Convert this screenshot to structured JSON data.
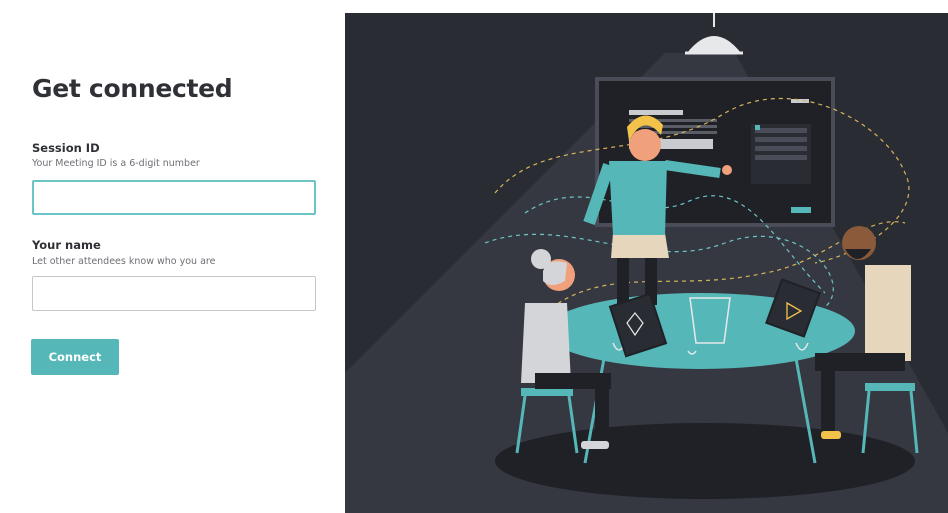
{
  "form": {
    "title": "Get connected",
    "session": {
      "label": "Session ID",
      "hint": "Your Meeting ID is a 6-digit number",
      "value": "",
      "placeholder": ""
    },
    "name": {
      "label": "Your name",
      "hint": "Let other attendees know who you are",
      "value": "",
      "placeholder": ""
    },
    "connect_label": "Connect"
  },
  "colors": {
    "accent": "#55b7b8",
    "field_focus": "#6cc4c6",
    "illustration_bg": "#2a2c33"
  }
}
